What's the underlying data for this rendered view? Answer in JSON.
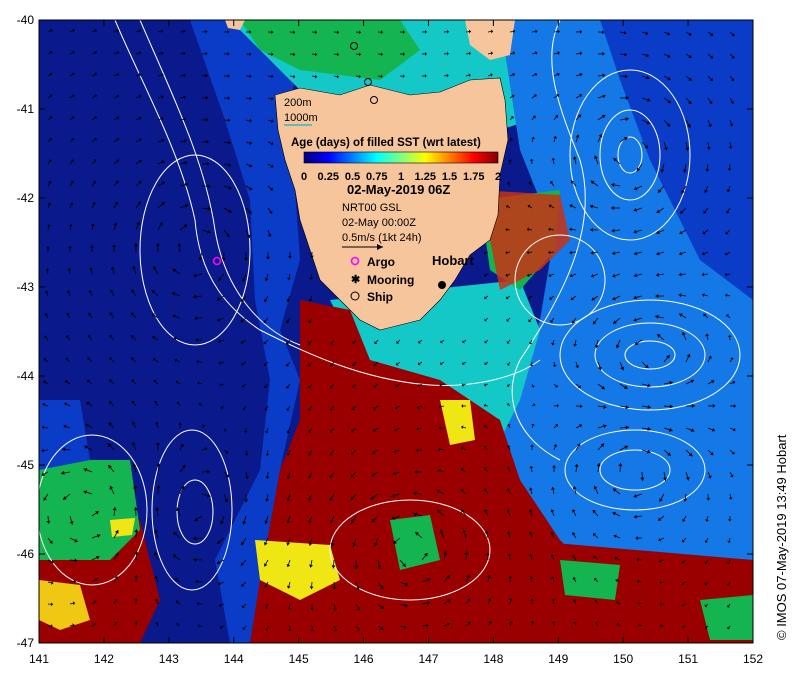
{
  "map": {
    "lon_range": [
      141,
      152
    ],
    "lat_range": [
      -47,
      -40
    ],
    "x_ticks": [
      "141",
      "142",
      "143",
      "144",
      "145",
      "146",
      "147",
      "148",
      "149",
      "150",
      "151",
      "152"
    ],
    "y_ticks": [
      "-40",
      "-41",
      "-42",
      "-43",
      "-44",
      "-45",
      "-46",
      "-47"
    ]
  },
  "legend": {
    "contour_200": "200m",
    "contour_1000": "1000m",
    "colorbar_title": "Age (days) of filled SST (wrt latest)",
    "colorbar_ticks": [
      "0",
      "0.25",
      "0.5",
      "0.75",
      "1",
      "1.25",
      "1.5",
      "1.75",
      "2"
    ],
    "colorbar_colors": [
      "#00007f",
      "#0000ff",
      "#007fff",
      "#00ffff",
      "#7fff7f",
      "#ffff00",
      "#ff7f00",
      "#ff0000",
      "#7f0000"
    ],
    "datetime": "02-May-2019 06Z",
    "model_label": "NRT00 GSL",
    "velocity_time": "02-May 00:00Z",
    "velocity_scale": "0.5m/s (1kt 24h)",
    "argo_label": "Argo",
    "mooring_label": "Mooring",
    "ship_label": "Ship",
    "city_label": "Hobart"
  },
  "credit": "© IMOS 07-May-2019 13:49 Hobart",
  "colors": {
    "deep_blue": "#0a1a8c",
    "blue": "#0a3cc8",
    "light_blue": "#1478e6",
    "cyan": "#14c8c8",
    "green": "#14b450",
    "yellow": "#f0e614",
    "dark_red": "#9a0000",
    "land": "#f7c59b",
    "argo": "#ff00ff"
  }
}
